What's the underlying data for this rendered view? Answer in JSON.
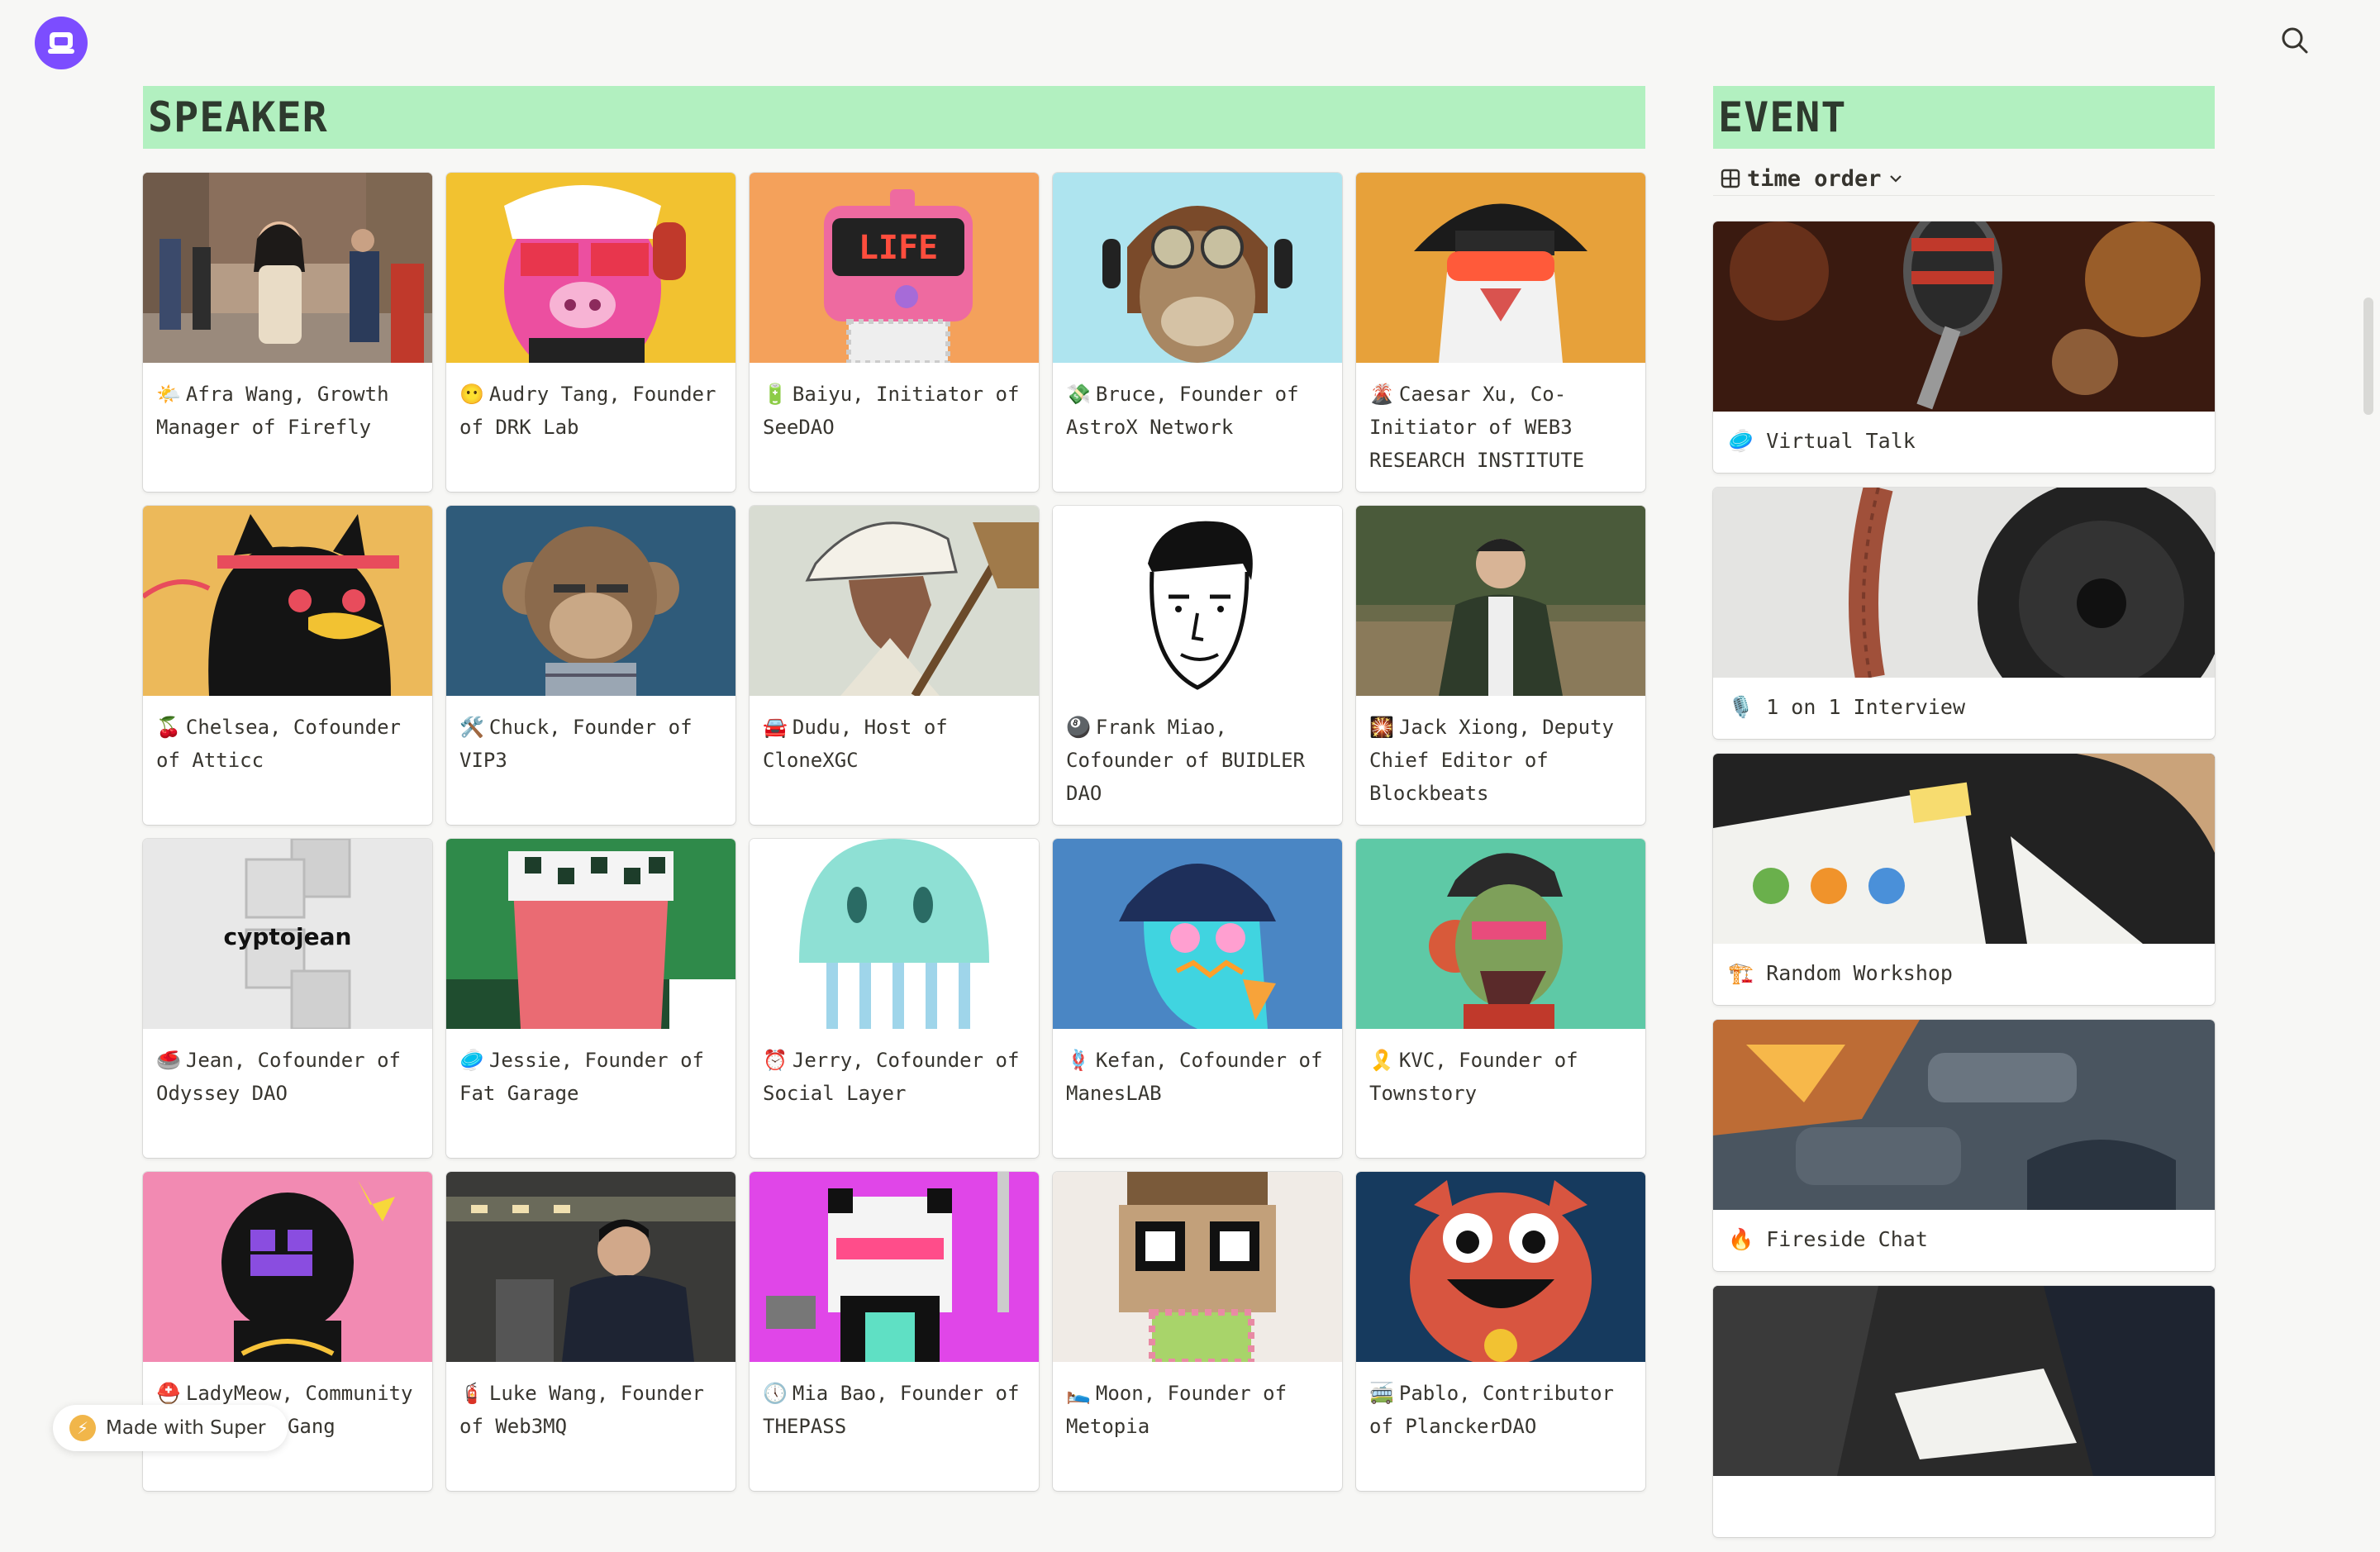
{
  "header": {
    "search_icon": "search-icon",
    "logo_icon": "super-logo-icon"
  },
  "speaker": {
    "title": "SPEAKER",
    "cards": [
      {
        "emoji": "🌤️",
        "label": "Afra Wang, Growth Manager of Firefly",
        "cover": "photo-woman-street"
      },
      {
        "emoji": "😶",
        "label": "Audry Tang, Founder of DRK Lab",
        "cover": "pink-bear-nft"
      },
      {
        "emoji": "🔋",
        "label": "Baiyu, Initiator of SeeDAO",
        "cover": "robot-life-nft"
      },
      {
        "emoji": "💸",
        "label": "Bruce, Founder of AstroX Network",
        "cover": "aviator-ape-nft"
      },
      {
        "emoji": "🌋",
        "label": "Caesar Xu, Co-Initiator of WEB3 RESEARCH INSTITUTE",
        "cover": "white-bird-nft"
      },
      {
        "emoji": "🍒",
        "label": "Chelsea, Cofounder of Atticc",
        "cover": "black-duck-nft"
      },
      {
        "emoji": "🛠️",
        "label": "Chuck, Founder of VIP3",
        "cover": "bored-ape-nft"
      },
      {
        "emoji": "🚘",
        "label": "Dudu, Host of CloneXGC",
        "cover": "anime-hat-nft"
      },
      {
        "emoji": "🎱",
        "label": "Frank Miao, Cofounder of BUIDLER DAO",
        "cover": "line-portrait"
      },
      {
        "emoji": "🎇",
        "label": "Jack Xiong, Deputy Chief Editor of Blockbeats",
        "cover": "photo-man-outdoor"
      },
      {
        "emoji": "🥌",
        "label": "Jean, Cofounder of Odyssey DAO",
        "cover": "cyptojean-cubes"
      },
      {
        "emoji": "🥏",
        "label": "Jessie, Founder of Fat Garage",
        "cover": "pixel-pot"
      },
      {
        "emoji": "⏰",
        "label": "Jerry, Cofounder of Social Layer",
        "cover": "jellyfish"
      },
      {
        "emoji": "🪢",
        "label": "Kefan, Cofounder of ManesLAB",
        "cover": "blue-hat-creature"
      },
      {
        "emoji": "🎗️",
        "label": "KVC, Founder of Townstory",
        "cover": "zombie-ape-nft"
      },
      {
        "emoji": "⛑️",
        "label": "LadyMeow, Community WeirdoGhostGang",
        "cover": "black-ghost-nft"
      },
      {
        "emoji": "🧯",
        "label": "Luke Wang, Founder of Web3MQ",
        "cover": "photo-man-laughing"
      },
      {
        "emoji": "🕔",
        "label": "Mia Bao, Founder of THEPASS",
        "cover": "pixel-cat-sword"
      },
      {
        "emoji": "🛌",
        "label": "Moon, Founder of Metopia",
        "cover": "pixel-glasses"
      },
      {
        "emoji": "🚎",
        "label": "Pablo, Contributor of PlanckerDAO",
        "cover": "red-monster"
      }
    ]
  },
  "event": {
    "title": "EVENT",
    "view_label": "time order",
    "cards": [
      {
        "emoji": "🥏",
        "label": "Virtual Talk",
        "cover": "microphone"
      },
      {
        "emoji": "🎙️",
        "label": "1 on 1 Interview",
        "cover": "film-reel"
      },
      {
        "emoji": "🏗️",
        "label": "Random Workshop",
        "cover": "workshop-table"
      },
      {
        "emoji": "🔥",
        "label": "Fireside Chat",
        "cover": "campfire"
      },
      {
        "emoji": "",
        "label": "",
        "cover": "notebook-lap"
      }
    ]
  },
  "footer": {
    "made_with": "Made with Super"
  }
}
